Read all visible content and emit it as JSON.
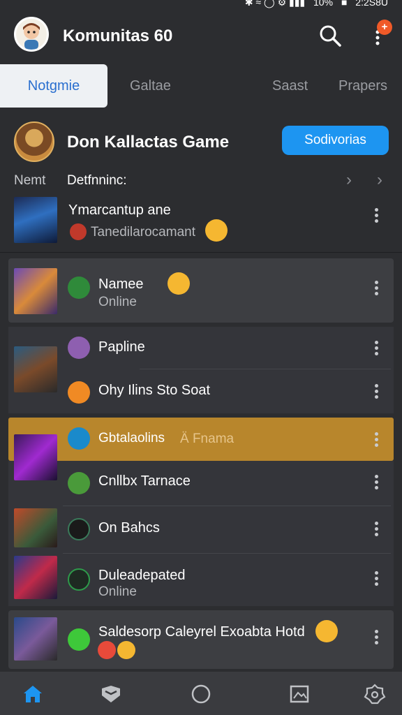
{
  "status_bar": {
    "battery": "10%",
    "time": "2:2S8U"
  },
  "app_bar": {
    "title": "Komunitas 60",
    "notification_badge": "+"
  },
  "tabs": [
    {
      "label": "Notgmie",
      "active": true
    },
    {
      "label": "Galtae",
      "active": false
    },
    {
      "label": "Saast",
      "active": false
    },
    {
      "label": "Prapers",
      "active": false
    }
  ],
  "community": {
    "name": "Don Kallactas Game",
    "action_button": "Sodivorias"
  },
  "section": {
    "left_label": "Nemt",
    "title": "Detfnninc:"
  },
  "featured": {
    "title": "Ymarcantup ane",
    "subtitle": "Tanedilarocamant"
  },
  "chat_rows": [
    {
      "title": "Namee",
      "subtitle": "Online"
    },
    {
      "title": "Papline",
      "subtitle": ""
    },
    {
      "title": "Ohy Ilins Sto Soat",
      "subtitle": ""
    },
    {
      "title": "Gbtalaolins",
      "subtitle": "Ä Fnama"
    },
    {
      "title": "Cnllbx Tarnace",
      "subtitle": ""
    },
    {
      "title": "On Bahcs",
      "subtitle": ""
    },
    {
      "title": "Duleadepated",
      "subtitle": "Online"
    },
    {
      "title": "Saldesorp Caleyrel Exoabta Hotd",
      "subtitle": ""
    }
  ],
  "colors": {
    "background": "#2c2d30",
    "accent": "#1d95f1",
    "tab_active": "#2a6fcf",
    "highlight": "#b8862c",
    "badge": "#f05a28"
  },
  "icons": {
    "search": "search-icon",
    "more": "more-vertical-icon",
    "nav": [
      "home-icon",
      "shield-icon",
      "circle-icon",
      "image-icon",
      "settings-icon"
    ]
  }
}
